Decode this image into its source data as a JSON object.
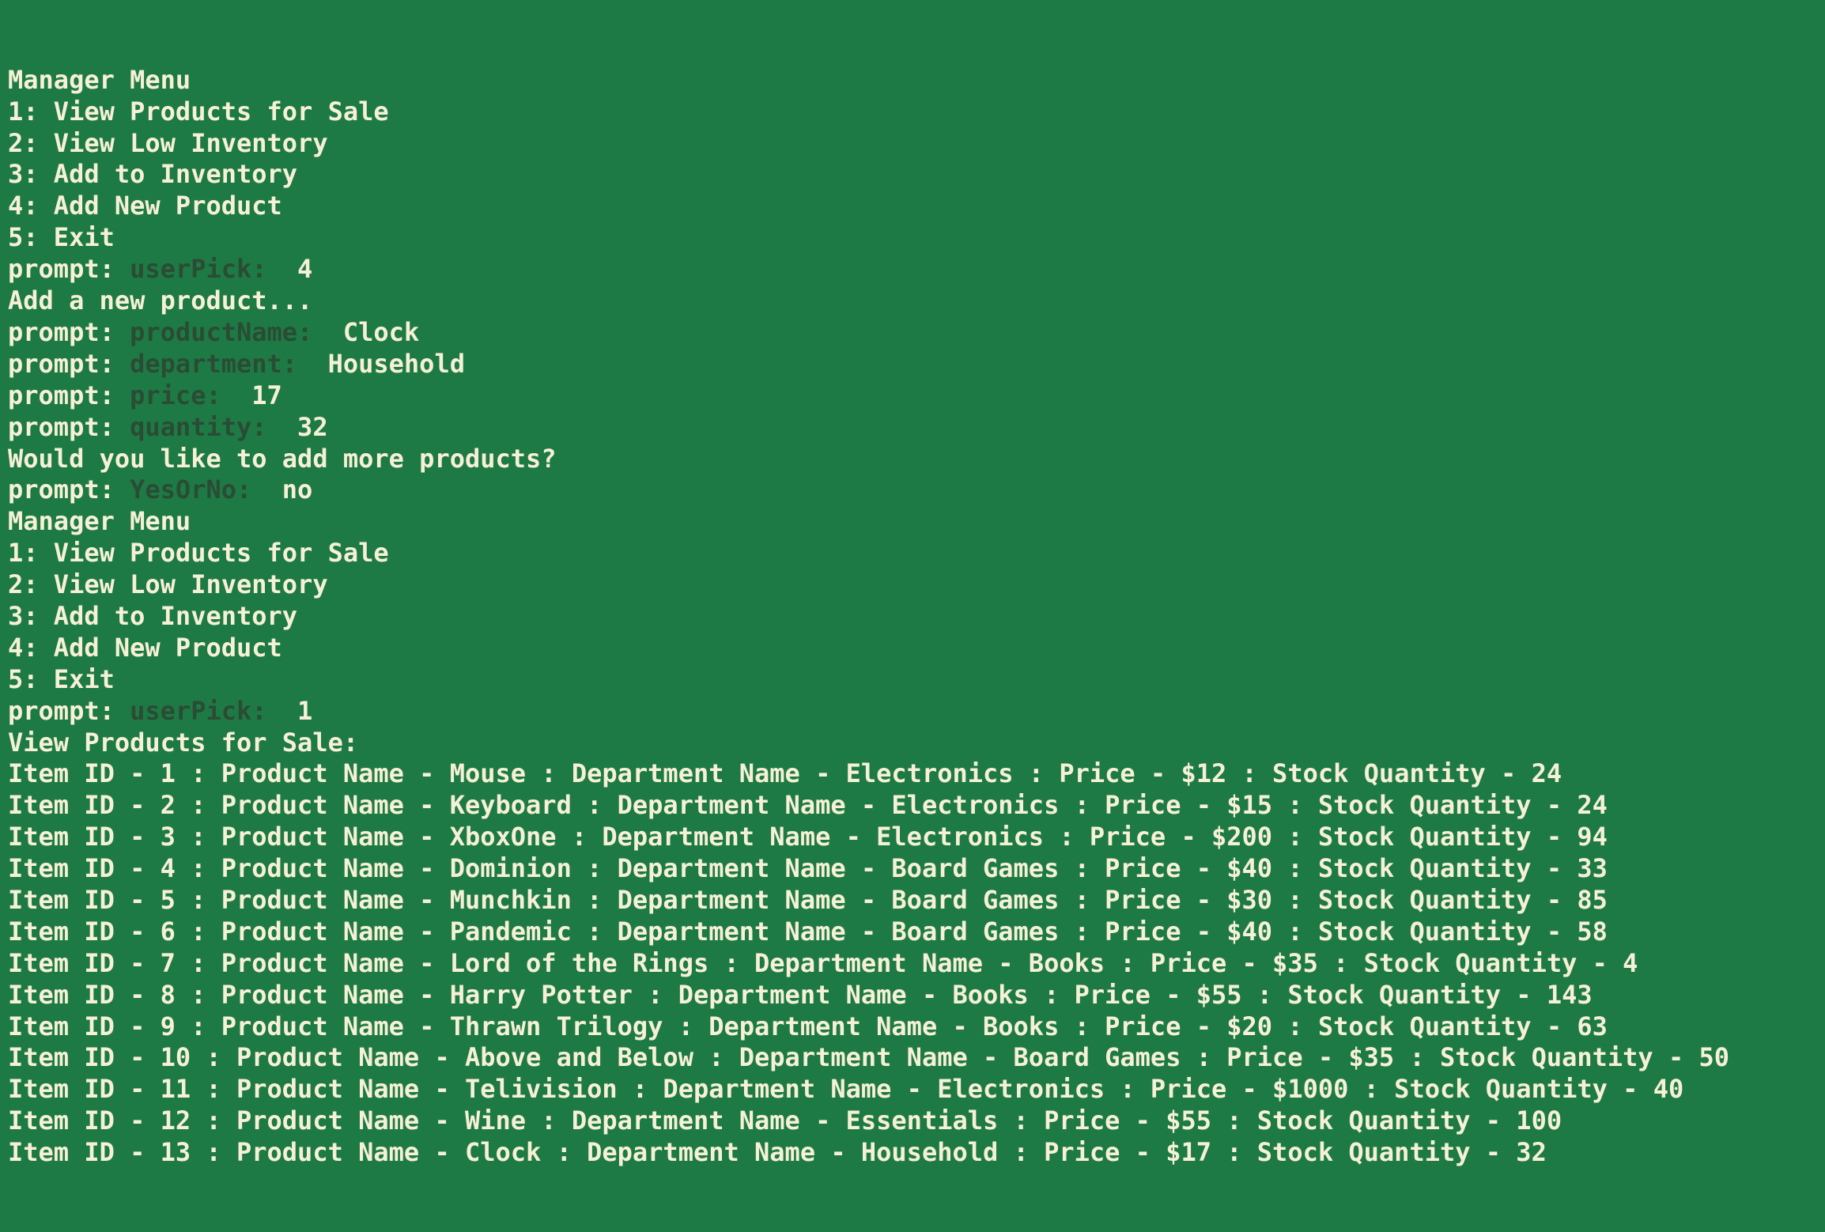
{
  "theme": {
    "background": "#1e7a44",
    "text": "#f6f1d6",
    "prompt_var": "#2a4c35"
  },
  "lines": [
    {
      "type": "text",
      "text": "Manager Menu"
    },
    {
      "type": "text",
      "text": "1: View Products for Sale"
    },
    {
      "type": "text",
      "text": "2: View Low Inventory"
    },
    {
      "type": "text",
      "text": "3: Add to Inventory"
    },
    {
      "type": "text",
      "text": "4: Add New Product"
    },
    {
      "type": "text",
      "text": "5: Exit"
    },
    {
      "type": "prompt",
      "label": "prompt:",
      "var": "userPick:",
      "answer": "4"
    },
    {
      "type": "text",
      "text": "Add a new product..."
    },
    {
      "type": "prompt",
      "label": "prompt:",
      "var": "productName:",
      "answer": "Clock"
    },
    {
      "type": "prompt",
      "label": "prompt:",
      "var": "department:",
      "answer": "Household"
    },
    {
      "type": "prompt",
      "label": "prompt:",
      "var": "price:",
      "answer": "17"
    },
    {
      "type": "prompt",
      "label": "prompt:",
      "var": "quantity:",
      "answer": "32"
    },
    {
      "type": "text",
      "text": "Would you like to add more products?"
    },
    {
      "type": "prompt",
      "label": "prompt:",
      "var": "YesOrNo:",
      "answer": "no"
    },
    {
      "type": "text",
      "text": "Manager Menu"
    },
    {
      "type": "text",
      "text": "1: View Products for Sale"
    },
    {
      "type": "text",
      "text": "2: View Low Inventory"
    },
    {
      "type": "text",
      "text": "3: Add to Inventory"
    },
    {
      "type": "text",
      "text": "4: Add New Product"
    },
    {
      "type": "text",
      "text": "5: Exit"
    },
    {
      "type": "prompt",
      "label": "prompt:",
      "var": "userPick:",
      "answer": "1"
    },
    {
      "type": "text",
      "text": "View Products for Sale:"
    },
    {
      "type": "text",
      "text": "Item ID - 1 : Product Name - Mouse : Department Name - Electronics : Price - $12 : Stock Quantity - 24"
    },
    {
      "type": "text",
      "text": "Item ID - 2 : Product Name - Keyboard : Department Name - Electronics : Price - $15 : Stock Quantity - 24"
    },
    {
      "type": "text",
      "text": "Item ID - 3 : Product Name - XboxOne : Department Name - Electronics : Price - $200 : Stock Quantity - 94"
    },
    {
      "type": "text",
      "text": "Item ID - 4 : Product Name - Dominion : Department Name - Board Games : Price - $40 : Stock Quantity - 33"
    },
    {
      "type": "text",
      "text": "Item ID - 5 : Product Name - Munchkin : Department Name - Board Games : Price - $30 : Stock Quantity - 85"
    },
    {
      "type": "text",
      "text": "Item ID - 6 : Product Name - Pandemic : Department Name - Board Games : Price - $40 : Stock Quantity - 58"
    },
    {
      "type": "text",
      "text": "Item ID - 7 : Product Name - Lord of the Rings : Department Name - Books : Price - $35 : Stock Quantity - 4"
    },
    {
      "type": "text",
      "text": "Item ID - 8 : Product Name - Harry Potter : Department Name - Books : Price - $55 : Stock Quantity - 143"
    },
    {
      "type": "text",
      "text": "Item ID - 9 : Product Name - Thrawn Trilogy : Department Name - Books : Price - $20 : Stock Quantity - 63"
    },
    {
      "type": "text",
      "text": "Item ID - 10 : Product Name - Above and Below : Department Name - Board Games : Price - $35 : Stock Quantity - 50"
    },
    {
      "type": "text",
      "text": "Item ID - 11 : Product Name - Telivision : Department Name - Electronics : Price - $1000 : Stock Quantity - 40"
    },
    {
      "type": "text",
      "text": "Item ID - 12 : Product Name - Wine : Department Name - Essentials : Price - $55 : Stock Quantity - 100"
    },
    {
      "type": "text",
      "text": "Item ID - 13 : Product Name - Clock : Department Name - Household : Price - $17 : Stock Quantity - 32"
    }
  ]
}
